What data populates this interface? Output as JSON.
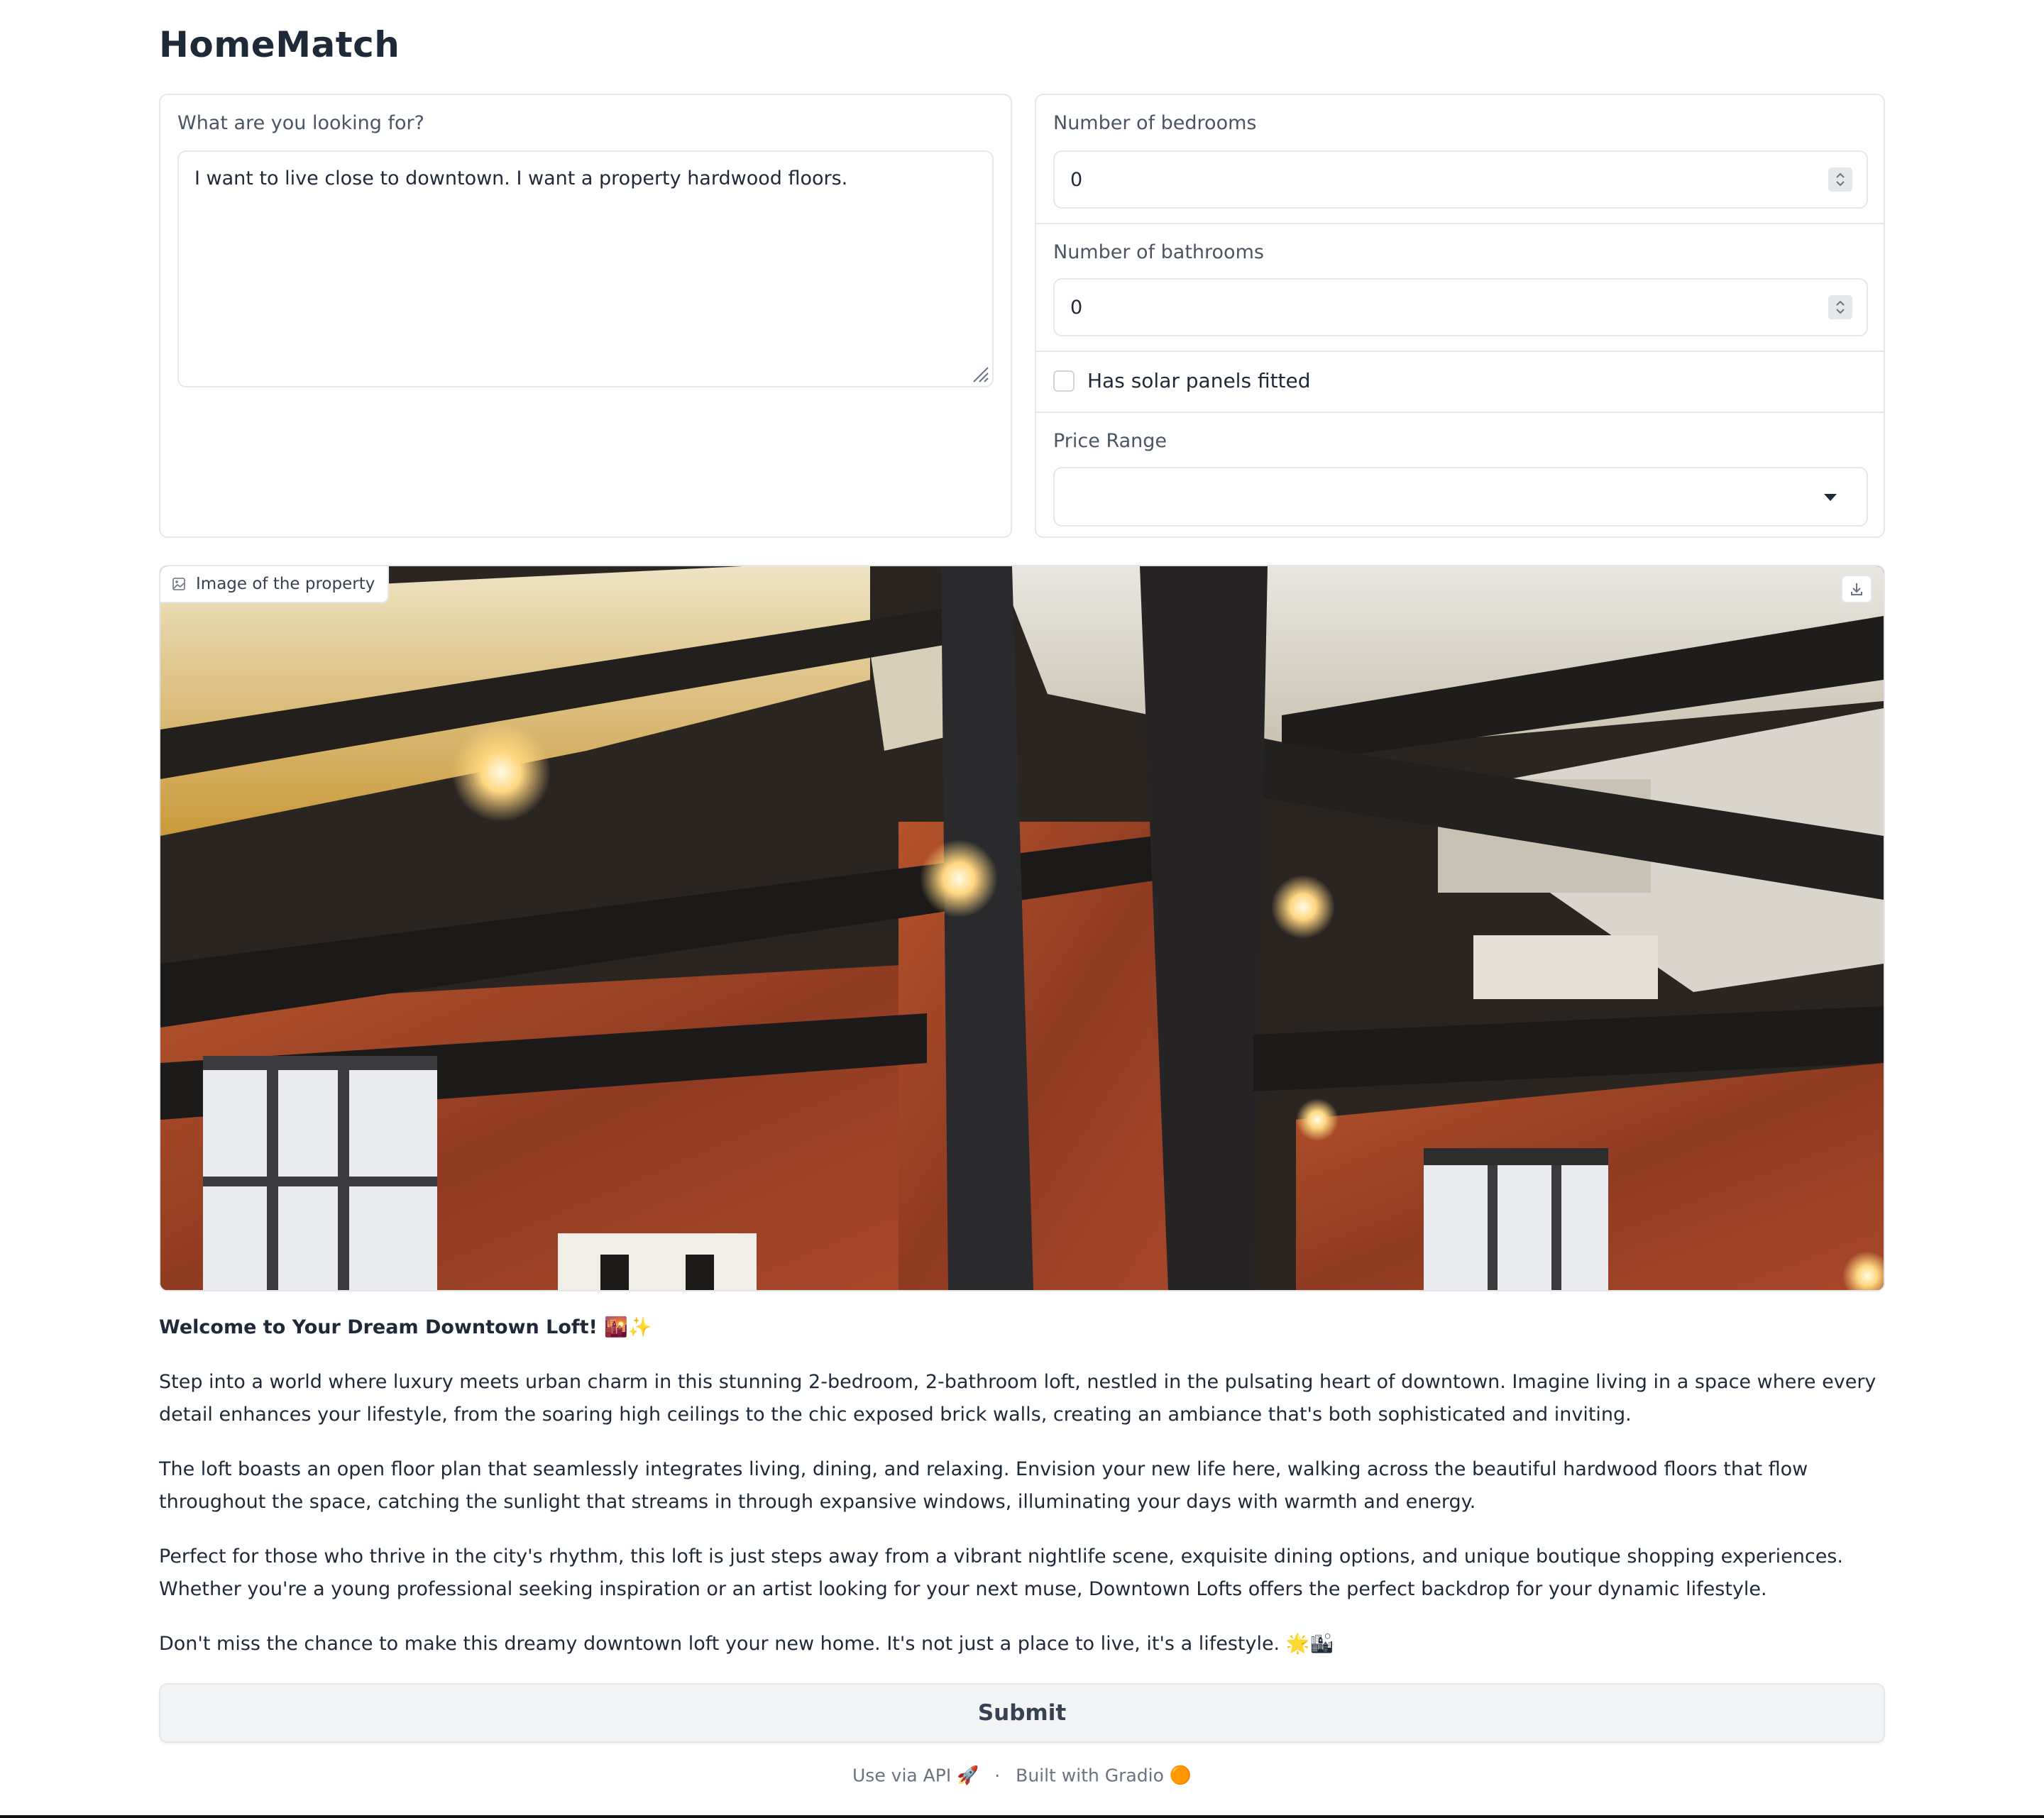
{
  "app": {
    "title": "HomeMatch"
  },
  "query": {
    "label": "What are you looking for?",
    "value": "I want to live close to downtown. I want a property hardwood floors."
  },
  "bedrooms": {
    "label": "Number of bedrooms",
    "value": "0"
  },
  "bathrooms": {
    "label": "Number of bathrooms",
    "value": "0"
  },
  "solar": {
    "label": "Has solar panels fitted",
    "checked": false
  },
  "price": {
    "label": "Price Range",
    "value": ""
  },
  "image": {
    "label": "Image of the property",
    "icons": {
      "label_icon": "image-icon",
      "download": "download-icon"
    }
  },
  "description": {
    "headline": "Welcome to Your Dream Downtown Loft! 🌇✨",
    "paragraphs": [
      "Step into a world where luxury meets urban charm in this stunning 2-bedroom, 2-bathroom loft, nestled in the pulsating heart of downtown. Imagine living in a space where every detail enhances your lifestyle, from the soaring high ceilings to the chic exposed brick walls, creating an ambiance that's both sophisticated and inviting.",
      "The loft boasts an open floor plan that seamlessly integrates living, dining, and relaxing. Envision your new life here, walking across the beautiful hardwood floors that flow throughout the space, catching the sunlight that streams in through expansive windows, illuminating your days with warmth and energy.",
      "Perfect for those who thrive in the city's rhythm, this loft is just steps away from a vibrant nightlife scene, exquisite dining options, and unique boutique shopping experiences. Whether you're a young professional seeking inspiration or an artist looking for your next muse, Downtown Lofts offers the perfect backdrop for your dynamic lifestyle.",
      "Don't miss the chance to make this dreamy downtown loft your new home. It's not just a place to live, it's a lifestyle. 🌟🏙"
    ]
  },
  "submit": {
    "label": "Submit"
  },
  "footer": {
    "api_label": "Use via API",
    "api_icon": "🚀",
    "separator": "·",
    "built_label": "Built with Gradio",
    "built_icon": "🟠"
  },
  "colors": {
    "border": "#e5e7eb",
    "text": "#1f2937",
    "muted": "#6b7280",
    "button_bg": "#f3f4f6"
  }
}
